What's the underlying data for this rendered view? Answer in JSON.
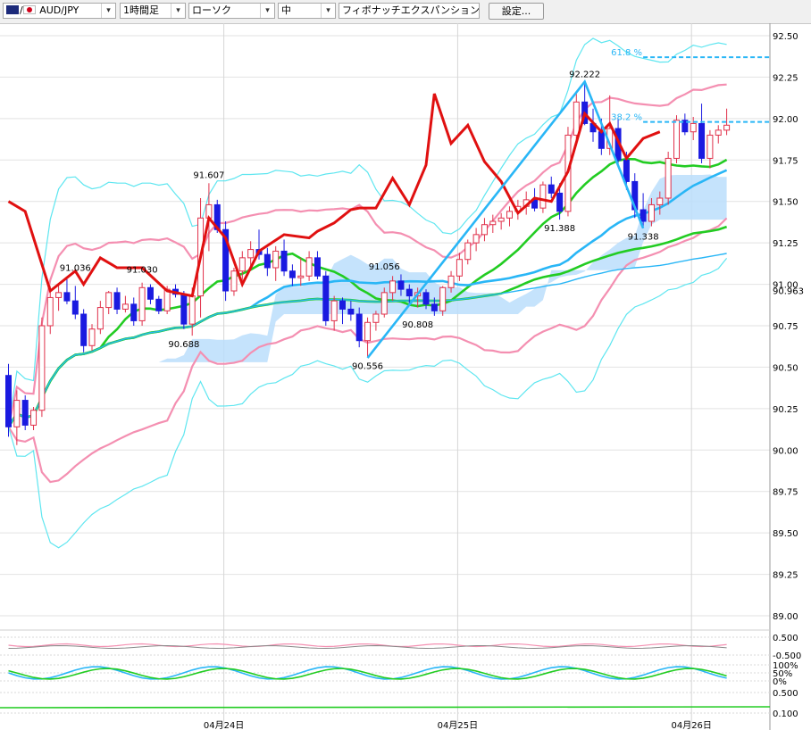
{
  "toolbar": {
    "symbol": "AUD/JPY",
    "timeframe": "1時間足",
    "chart_type": "ローソク",
    "size": "中",
    "indicator_input": "フィボナッチエクスパンション",
    "settings_label": "設定..."
  },
  "colors": {
    "bullish_body": "#ffffff",
    "bullish_border": "#e0304a",
    "bearish_body": "#1a1ae0",
    "tenkan": "#e01010",
    "ma_short": "#29b6f6",
    "ma_long": "#22cc22",
    "bb_pink": "#f48fb1",
    "bb_cyan": "#5ee6f0",
    "cloud": "#bbdefb",
    "cloud_pink": "#f8bbd0",
    "fib": "#29b6f6"
  },
  "price_axis": {
    "labels": [
      "92.50",
      "92.25",
      "92.00",
      "91.75",
      "91.50",
      "91.25",
      "91.00",
      "90.75",
      "90.50",
      "90.25",
      "90.00",
      "89.75",
      "89.50",
      "89.25",
      "89.00"
    ],
    "current_price": "90.963"
  },
  "date_axis": {
    "labels": [
      "04月24日",
      "04月25日",
      "04月26日"
    ]
  },
  "annotations": {
    "peaks": [
      "91.036",
      "91.030",
      "91.607",
      "90.688",
      "91.056",
      "90.556",
      "90.808",
      "92.222",
      "91.388",
      "91.338"
    ],
    "fib_618": "61.8 %",
    "fib_382": "38.2 %"
  },
  "sub_panels": {
    "osc_labels": [
      "0.500",
      "-0.500"
    ],
    "stoch_labels": [
      "100%",
      "50%",
      "0%"
    ],
    "macd_labels": [
      "0.500",
      "0.100"
    ]
  },
  "chart_data": {
    "type": "candlestick",
    "symbol": "AUD/JPY",
    "timeframe": "1時間足",
    "ylim": [
      89.0,
      92.5
    ],
    "x_ticks": [
      "04月24日",
      "04月25日",
      "04月26日"
    ],
    "candles": [
      [
        90.45,
        90.52,
        90.08,
        90.14
      ],
      [
        90.14,
        90.36,
        90.03,
        90.3
      ],
      [
        90.3,
        90.33,
        90.12,
        90.15
      ],
      [
        90.15,
        90.26,
        90.12,
        90.24
      ],
      [
        90.24,
        90.8,
        90.2,
        90.75
      ],
      [
        90.75,
        90.99,
        90.7,
        90.92
      ],
      [
        90.92,
        91.0,
        90.84,
        90.95
      ],
      [
        90.95,
        91.03,
        90.88,
        90.9
      ],
      [
        90.9,
        90.99,
        90.79,
        90.82
      ],
      [
        90.82,
        90.85,
        90.59,
        90.63
      ],
      [
        90.63,
        90.76,
        90.6,
        90.73
      ],
      [
        90.73,
        90.9,
        90.7,
        90.86
      ],
      [
        90.86,
        90.96,
        90.82,
        90.95
      ],
      [
        90.95,
        90.98,
        90.82,
        90.85
      ],
      [
        90.85,
        90.93,
        90.83,
        90.88
      ],
      [
        90.88,
        90.92,
        90.75,
        90.78
      ],
      [
        90.78,
        91.01,
        90.75,
        90.98
      ],
      [
        90.98,
        91.0,
        90.88,
        90.91
      ],
      [
        90.91,
        90.93,
        90.82,
        90.84
      ],
      [
        90.84,
        90.99,
        90.82,
        90.97
      ],
      [
        90.97,
        91.0,
        90.92,
        90.94
      ],
      [
        90.94,
        90.96,
        90.73,
        90.76
      ],
      [
        90.76,
        90.98,
        90.69,
        90.93
      ],
      [
        90.93,
        91.52,
        90.8,
        91.4
      ],
      [
        91.4,
        91.61,
        91.2,
        91.48
      ],
      [
        91.48,
        91.51,
        91.31,
        91.33
      ],
      [
        91.33,
        91.38,
        90.9,
        90.96
      ],
      [
        90.96,
        91.1,
        90.93,
        91.08
      ],
      [
        91.08,
        91.2,
        91.02,
        91.16
      ],
      [
        91.16,
        91.26,
        91.08,
        91.21
      ],
      [
        91.21,
        91.33,
        91.15,
        91.18
      ],
      [
        91.18,
        91.22,
        91.05,
        91.1
      ],
      [
        91.1,
        91.23,
        91.02,
        91.2
      ],
      [
        91.2,
        91.27,
        91.05,
        91.08
      ],
      [
        91.08,
        91.12,
        90.99,
        91.04
      ],
      [
        91.04,
        91.16,
        90.99,
        91.05
      ],
      [
        91.05,
        91.2,
        91.02,
        91.16
      ],
      [
        91.16,
        91.2,
        91.03,
        91.05
      ],
      [
        91.05,
        91.08,
        90.75,
        90.78
      ],
      [
        90.78,
        90.93,
        90.72,
        90.9
      ],
      [
        90.9,
        90.92,
        90.76,
        90.85
      ],
      [
        90.85,
        90.9,
        90.78,
        90.82
      ],
      [
        90.82,
        90.86,
        90.62,
        90.66
      ],
      [
        90.66,
        90.8,
        90.56,
        90.77
      ],
      [
        90.77,
        90.84,
        90.72,
        90.82
      ],
      [
        90.82,
        90.98,
        90.8,
        90.95
      ],
      [
        90.95,
        91.05,
        90.9,
        91.02
      ],
      [
        91.02,
        91.06,
        90.93,
        90.97
      ],
      [
        90.97,
        91.0,
        90.88,
        90.93
      ],
      [
        90.93,
        90.98,
        90.86,
        90.95
      ],
      [
        90.95,
        90.97,
        90.85,
        90.88
      ],
      [
        90.88,
        90.92,
        90.81,
        90.84
      ],
      [
        90.84,
        90.99,
        90.81,
        90.98
      ],
      [
        90.98,
        91.08,
        90.95,
        91.05
      ],
      [
        91.05,
        91.19,
        91.02,
        91.15
      ],
      [
        91.15,
        91.27,
        91.12,
        91.25
      ],
      [
        91.25,
        91.34,
        91.2,
        91.3
      ],
      [
        91.3,
        91.4,
        91.26,
        91.36
      ],
      [
        91.36,
        91.42,
        91.31,
        91.38
      ],
      [
        91.38,
        91.43,
        91.33,
        91.4
      ],
      [
        91.4,
        91.47,
        91.35,
        91.44
      ],
      [
        91.44,
        91.51,
        91.39,
        91.47
      ],
      [
        91.47,
        91.56,
        91.42,
        91.51
      ],
      [
        91.51,
        91.58,
        91.44,
        91.46
      ],
      [
        91.46,
        91.62,
        91.43,
        91.6
      ],
      [
        91.6,
        91.65,
        91.52,
        91.55
      ],
      [
        91.55,
        91.61,
        91.39,
        91.44
      ],
      [
        91.44,
        91.95,
        91.41,
        91.9
      ],
      [
        91.9,
        92.16,
        91.85,
        92.1
      ],
      [
        92.1,
        92.22,
        91.96,
        91.97
      ],
      [
        91.97,
        92.06,
        91.86,
        91.92
      ],
      [
        91.92,
        92.0,
        91.78,
        91.82
      ],
      [
        91.82,
        92.14,
        91.78,
        91.94
      ],
      [
        91.94,
        92.0,
        91.72,
        91.75
      ],
      [
        91.75,
        91.8,
        91.57,
        91.62
      ],
      [
        91.62,
        91.67,
        91.4,
        91.45
      ],
      [
        91.45,
        91.55,
        91.34,
        91.38
      ],
      [
        91.38,
        91.52,
        91.35,
        91.48
      ],
      [
        91.48,
        91.56,
        91.42,
        91.52
      ],
      [
        91.52,
        91.8,
        91.48,
        91.76
      ],
      [
        91.76,
        92.02,
        91.73,
        91.99
      ],
      [
        91.99,
        92.03,
        91.9,
        91.92
      ],
      [
        91.92,
        92.01,
        91.87,
        91.97
      ],
      [
        91.97,
        92.09,
        91.73,
        91.76
      ],
      [
        91.76,
        91.93,
        91.7,
        91.9
      ],
      [
        91.9,
        91.96,
        91.85,
        91.93
      ],
      [
        91.93,
        92.06,
        91.9,
        91.96
      ]
    ],
    "tenkan_line": [
      [
        0,
        91.5
      ],
      [
        2,
        91.44
      ],
      [
        5,
        90.96
      ],
      [
        8,
        91.08
      ],
      [
        9,
        91.0
      ],
      [
        11,
        91.16
      ],
      [
        13,
        91.1
      ],
      [
        16,
        91.1
      ],
      [
        19,
        90.96
      ],
      [
        22,
        90.93
      ],
      [
        24,
        91.4
      ],
      [
        26,
        91.28
      ],
      [
        28,
        91.0
      ],
      [
        30,
        91.2
      ],
      [
        33,
        91.3
      ],
      [
        36,
        91.28
      ],
      [
        37,
        91.32
      ],
      [
        39,
        91.37
      ],
      [
        41,
        91.45
      ],
      [
        42,
        91.46
      ],
      [
        44,
        91.46
      ],
      [
        46,
        91.64
      ],
      [
        48,
        91.48
      ],
      [
        50,
        91.72
      ],
      [
        51,
        92.15
      ],
      [
        53,
        91.85
      ],
      [
        55,
        91.96
      ],
      [
        57,
        91.74
      ],
      [
        59,
        91.62
      ],
      [
        61,
        91.43
      ],
      [
        63,
        91.52
      ],
      [
        65,
        91.5
      ],
      [
        67,
        91.68
      ],
      [
        69,
        92.03
      ],
      [
        71,
        91.92
      ],
      [
        72,
        91.97
      ],
      [
        74,
        91.76
      ],
      [
        76,
        91.88
      ],
      [
        78,
        91.92
      ]
    ]
  }
}
